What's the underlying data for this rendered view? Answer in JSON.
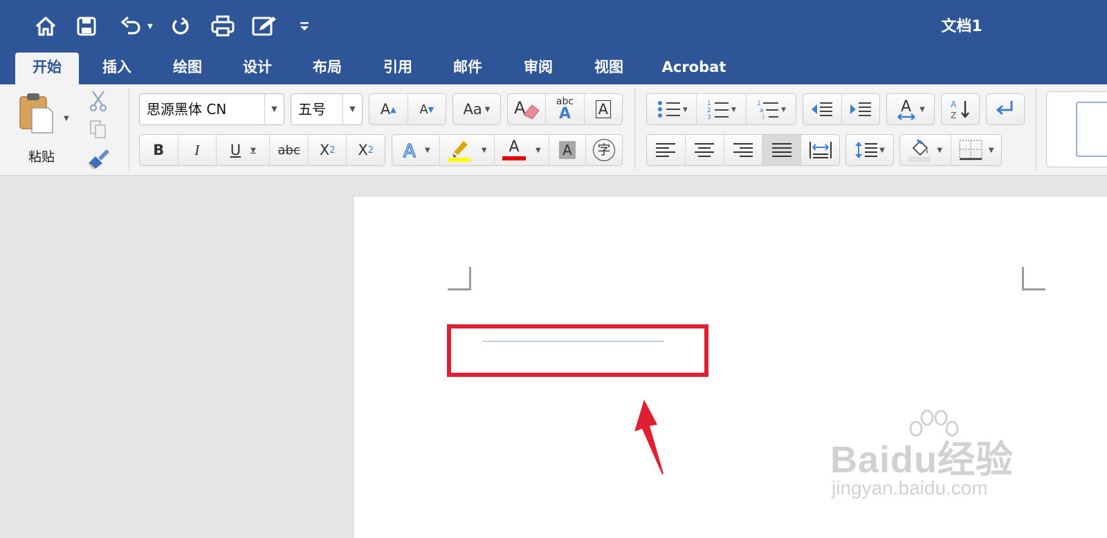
{
  "window": {
    "title": "文档1"
  },
  "quick_access": {
    "icons": [
      "home-icon",
      "save-icon",
      "undo-icon",
      "redo-icon",
      "print-icon",
      "edit-icon",
      "customize-icon"
    ]
  },
  "tabs": [
    {
      "label": "开始",
      "active": true
    },
    {
      "label": "插入"
    },
    {
      "label": "绘图"
    },
    {
      "label": "设计"
    },
    {
      "label": "布局"
    },
    {
      "label": "引用"
    },
    {
      "label": "邮件"
    },
    {
      "label": "审阅"
    },
    {
      "label": "视图"
    },
    {
      "label": "Acrobat"
    }
  ],
  "clipboard": {
    "paste_label": "粘贴"
  },
  "font": {
    "family": "思源黑体 CN",
    "size": "五号",
    "grow_label": "A",
    "shrink_label": "A",
    "bold": "B",
    "italic": "I",
    "underline": "U",
    "strike": "abc",
    "subscript": "X",
    "subscript_mark": "2",
    "superscript": "X",
    "superscript_mark": "2",
    "char_border": "A",
    "char_shade": "A",
    "enclose": "字",
    "phonetic_top": "abc",
    "phonetic_bottom": "A",
    "font_color_letter": "A",
    "case_letter": "Aa"
  },
  "colors": {
    "title_bar": "#2d5597",
    "highlight": "#ffff00",
    "font_color": "#e60000",
    "annotation": "#e02030"
  },
  "watermark": {
    "logo": "Baidu经验",
    "url": "jingyan.baidu.com"
  }
}
